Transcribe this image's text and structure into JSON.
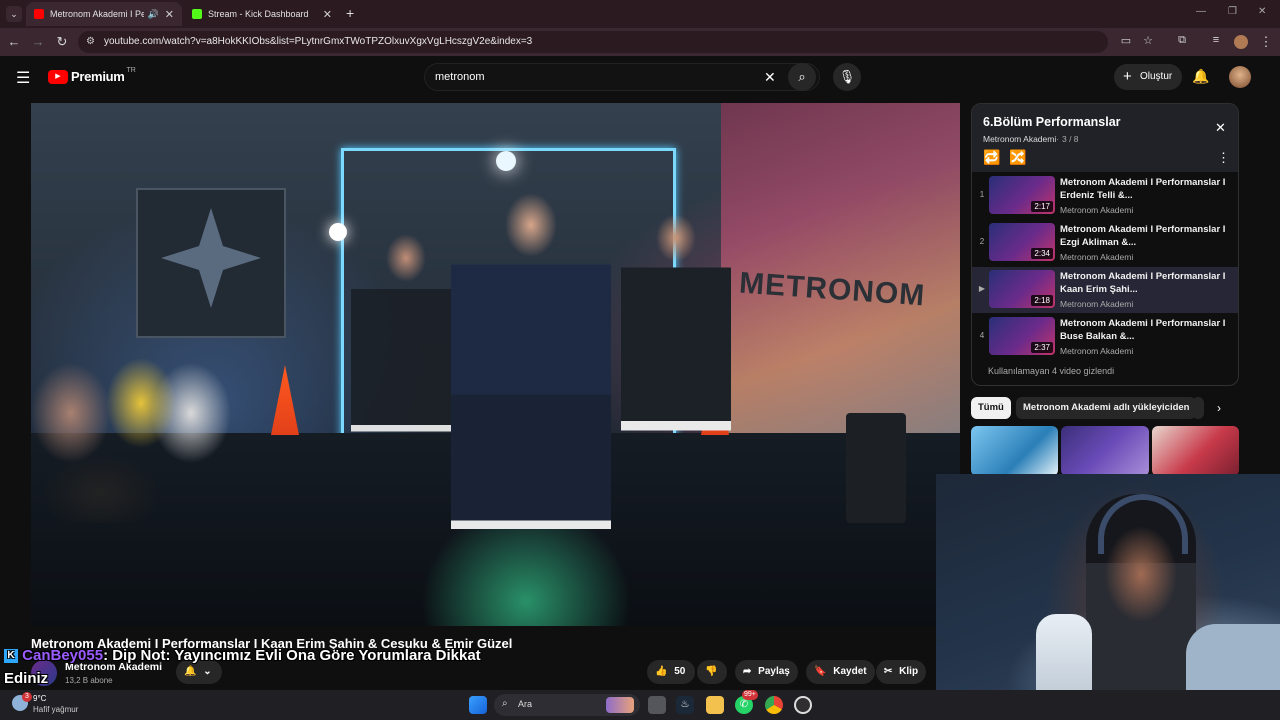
{
  "browser": {
    "tabs": [
      {
        "title": "Metronom Akademi I Perfo",
        "active": true
      },
      {
        "title": "Stream - Kick Dashboard",
        "active": false
      }
    ],
    "url": "youtube.com/watch?v=a8HokKKIObs&list=PLytnrGmxTWoTPZOlxuvXgxVgLHcszgV2e&index=3"
  },
  "youtube": {
    "logo": "Premium",
    "region": "TR",
    "search_query": "metronom",
    "create_label": "Oluştur"
  },
  "playlist": {
    "title": "6.Bölüm Performanslar",
    "channel": "Metronom Akademi",
    "position": "3 / 8",
    "items": [
      {
        "index": "1",
        "title": "Metronom Akademi I Performanslar I Erdeniz Telli &...",
        "channel": "Metronom Akademi",
        "duration": "2:17"
      },
      {
        "index": "2",
        "title": "Metronom Akademi I Performanslar I Ezgi Akliman &...",
        "channel": "Metronom Akademi",
        "duration": "2:34"
      },
      {
        "index": "▶",
        "title": "Metronom Akademi I Performanslar I Kaan Erim Şahi...",
        "channel": "Metronom Akademi",
        "duration": "2:18"
      },
      {
        "index": "4",
        "title": "Metronom Akademi I Performanslar I Buse Balkan &...",
        "channel": "Metronom Akademi",
        "duration": "2:37"
      }
    ],
    "hidden_note": "Kullanılamayan 4 video gizlendi"
  },
  "chips": [
    "Tümü",
    "Metronom Akademi adlı yükleyiciden"
  ],
  "video": {
    "title": "Metronom Akademi I Performanslar I Kaan Erim Şahin & Cesuku & Emir Güzel",
    "channel": "Metronom Akademi",
    "subscribers": "13,2 B abone",
    "likes": "50",
    "share_label": "Paylaş",
    "save_label": "Kaydet",
    "clip_label": "Klip",
    "stage_sign": "METRONOM"
  },
  "chat": {
    "user": "CanBey055",
    "message": ": Dip Not: Yayıncımız Evli Ona Göre Yorumlara Dikkat",
    "partial_word": "Ediniz"
  },
  "taskbar": {
    "weather_temp": "9°C",
    "weather_desc": "Hafif yağmur",
    "weather_badge": "3",
    "search_label": "Ara",
    "whatsapp_badge": "99+"
  }
}
